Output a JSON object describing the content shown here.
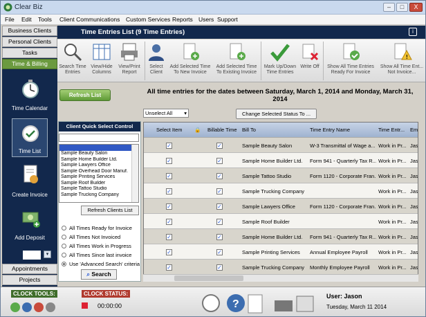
{
  "app": {
    "title": "Clear Biz",
    "minimize": "–",
    "maximize": "□",
    "close": "X",
    "help": "i"
  },
  "menu": [
    "File",
    "Edit",
    "Tools",
    "Client Communications",
    "Custom Services",
    "Reports",
    "Users",
    "Support"
  ],
  "nav": {
    "tabs_top": [
      "Business Clients",
      "Personal Clients",
      "Tasks",
      "Time & Billing"
    ],
    "items": [
      "Time Calendar",
      "Time List",
      "Create Invoice",
      "Add Deposit"
    ],
    "tabs_bottom": [
      "Appointments",
      "Projects"
    ]
  },
  "header": {
    "title": "Time Entries List (9 Time Entries)"
  },
  "ribbon": [
    {
      "label": "Search Time Entries",
      "icon": "search-icon"
    },
    {
      "label": "View/Hide Columns",
      "icon": "columns-icon"
    },
    {
      "label": "View/Print Report",
      "icon": "print-icon"
    },
    {
      "label": "Select Client",
      "icon": "user-icon"
    },
    {
      "label": "Add Selected Time To New Invoice",
      "icon": "new-invoice-icon"
    },
    {
      "label": "Add Selected Time To Existing Invoice",
      "icon": "existing-invoice-icon"
    },
    {
      "label": "Mark Up/Down Time Entries",
      "icon": "checkmark-icon"
    },
    {
      "label": "Write Off",
      "icon": "write-off-icon"
    },
    {
      "label": "Show All Time Entries Ready For Invoice",
      "icon": "ready-icon"
    },
    {
      "label": "Show All Time Ent... Not Invoice...",
      "icon": "warning-icon"
    }
  ],
  "refresh_label": "Refresh List",
  "date_header": "All time entries for the dates between Saturday, March 1, 2014 and Monday, March 31, 2014",
  "unselect": "Unselect All",
  "change_status": "Change Selected Status To ...",
  "panel": {
    "title": "Client Quick Select Control",
    "search_value": "",
    "clients": [
      "Sample Beauty Salon",
      "Sample Home Builder Ltd.",
      "Sample Lawyers Office",
      "Sample Overhead Door Manuf.",
      "Sample Printing Services",
      "Sample Roof Builder",
      "Sample Tattoo Studio",
      "Sample Trucking Company"
    ],
    "refresh_clients": "Refresh Clients List",
    "radios": [
      "All Times Ready for Invoice",
      "All Times Not Invoiced",
      "All Times Work in Progress",
      "All Times Since last invoice",
      "Use 'Advanced Search' criteria"
    ],
    "search_button": "Search"
  },
  "grid": {
    "columns": [
      "Select Item",
      "",
      "Billable Time",
      "Bill To",
      "Time Entry Name",
      "Time Entr...",
      "Em"
    ],
    "rows": [
      [
        "Sample Beauty Salon",
        "W-3 Transmittal of Wage a...",
        "Work in Pr...",
        "Jas"
      ],
      [
        "Sample Home Builder Ltd.",
        "Form 941 - Quarterly Tax R...",
        "Work in Pr...",
        "Jas"
      ],
      [
        "Sample Tattoo Studio",
        "Form 1120 - Corporate Fran...",
        "Work in Pr...",
        "Jas"
      ],
      [
        "Sample Trucking Company",
        "",
        "Work in Pr...",
        "Jas"
      ],
      [
        "Sample Lawyers Office",
        "Form 1120 - Corporate Fran...",
        "Work in Pr...",
        "Jas"
      ],
      [
        "Sample Roof Builder",
        "",
        "Work in Pr...",
        "Jas"
      ],
      [
        "Sample Home Builder Ltd.",
        "Form 941 - Quarterly Tax R...",
        "Work in Pr...",
        "Jas"
      ],
      [
        "Sample Printing Services",
        "Annual Employee Payroll",
        "Work in Pr...",
        "Jas"
      ],
      [
        "Sample Trucking Company",
        "Monthly Employee Payroll",
        "Work in Pr...",
        "Jas"
      ]
    ]
  },
  "bottom": {
    "clock_tools": "CLOCK TOOLS:",
    "clock_status": "CLOCK STATUS:",
    "timer": "00:00:00",
    "user": "User: Jason",
    "date": "Tuesday, March 11 2014"
  }
}
